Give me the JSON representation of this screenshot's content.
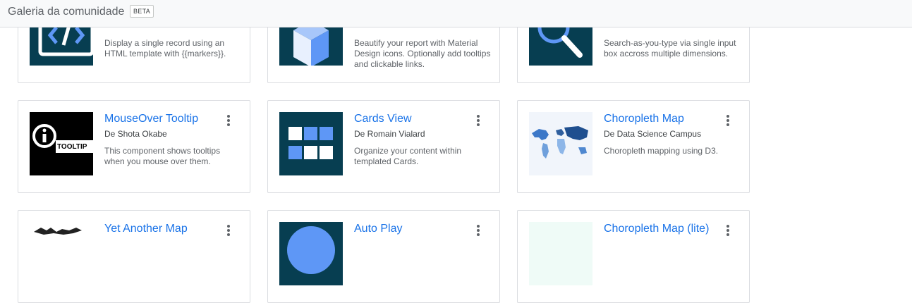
{
  "header": {
    "title": "Galeria da comunidade",
    "badge": "BETA"
  },
  "rows": [
    {
      "cards": [
        {
          "title": "",
          "author": "",
          "description": "Display a single record using an HTML template with {{markers}}.",
          "thumb": "code-icon"
        },
        {
          "title": "",
          "author": "",
          "description": "Beautify your report with Material Design icons. Optionally add tooltips and clickable links.",
          "thumb": "cube-icon"
        },
        {
          "title": "",
          "author": "",
          "description": "Search-as-you-type via single input box accross multiple dimensions.",
          "thumb": "magnifier-icon"
        }
      ]
    },
    {
      "cards": [
        {
          "title": "MouseOver Tooltip",
          "author": "De Shota Okabe",
          "description": "This component shows tooltips when you mouse over them.",
          "thumb": "info-tooltip-icon",
          "thumb_text": "TOOLTIP"
        },
        {
          "title": "Cards View",
          "author": "De Romain Vialard",
          "description": "Organize your content within templated Cards.",
          "thumb": "cards-grid-icon"
        },
        {
          "title": "Choropleth Map",
          "author": "De Data Science Campus",
          "description": "Choropleth mapping using D3.",
          "thumb": "world-map-icon"
        }
      ]
    },
    {
      "cards": [
        {
          "title": "Yet Another Map",
          "author": "",
          "description": "",
          "thumb": "map-silhouette-icon"
        },
        {
          "title": "Auto Play",
          "author": "",
          "description": "",
          "thumb": "play-circle-icon"
        },
        {
          "title": "Choropleth Map (lite)",
          "author": "",
          "description": "",
          "thumb": "light-map-icon"
        }
      ]
    }
  ],
  "colors": {
    "accent": "#1a73e8",
    "thumb_bg": "#073e51",
    "tile_blue": "#5e97f6"
  }
}
